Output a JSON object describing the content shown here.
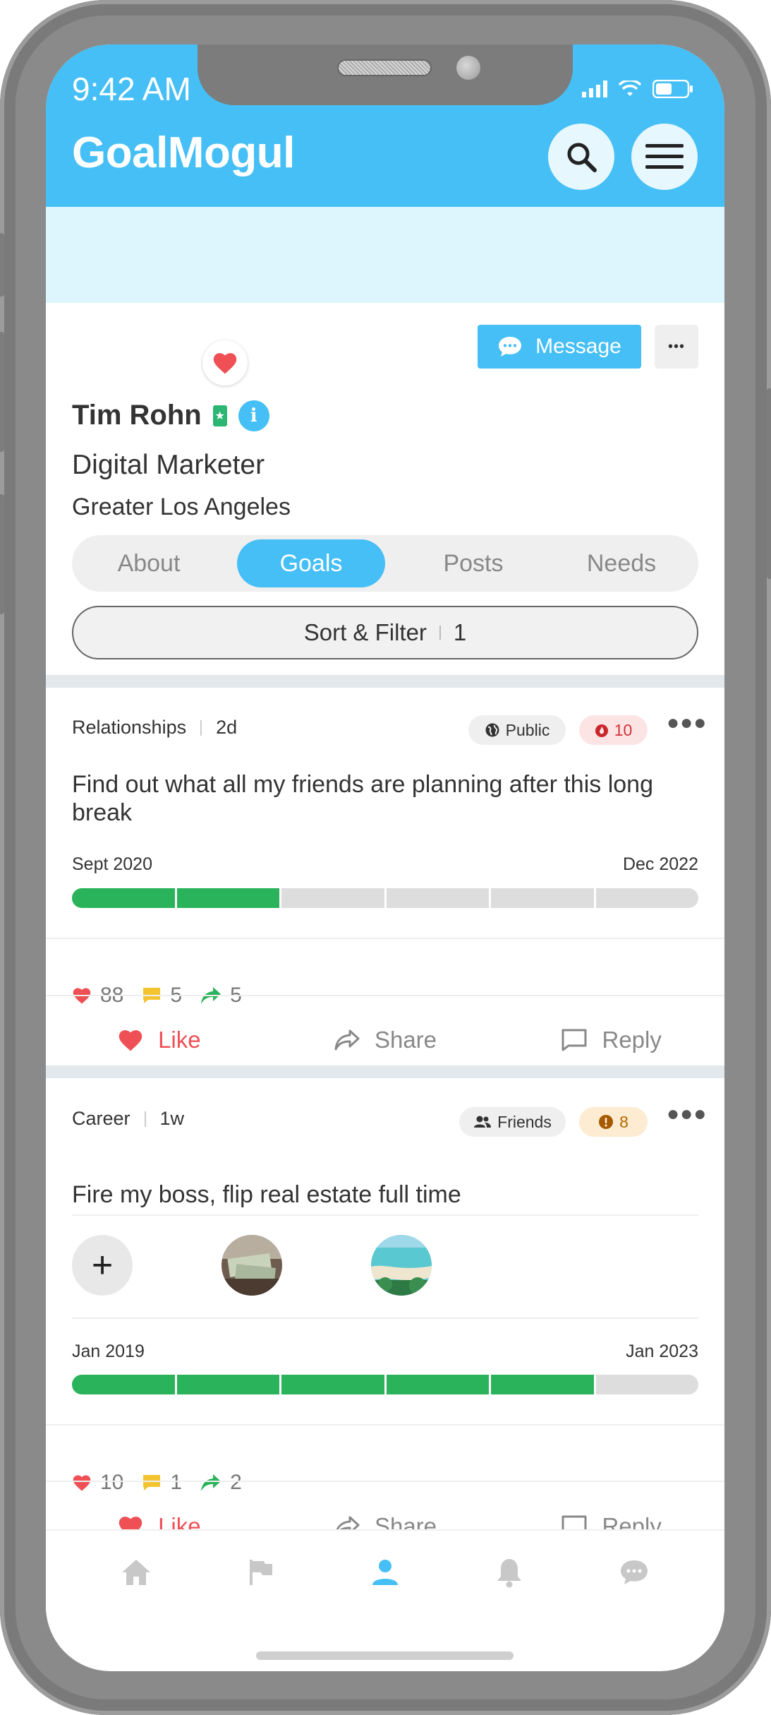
{
  "status_bar": {
    "time": "9:42 AM"
  },
  "app": {
    "name": "GoalMogul"
  },
  "profile": {
    "name": "Tim Rohn",
    "headline": "Digital Marketer",
    "location": "Greater Los Angeles",
    "message_label": "Message",
    "more_label": "•••"
  },
  "tabs": [
    {
      "label": "About",
      "active": false
    },
    {
      "label": "Goals",
      "active": true
    },
    {
      "label": "Posts",
      "active": false
    },
    {
      "label": "Needs",
      "active": false
    }
  ],
  "sort_filter": {
    "label": "Sort & Filter",
    "count": "1"
  },
  "goals": [
    {
      "category": "Relationships",
      "age": "2d",
      "privacy": "Public",
      "priority": "10",
      "title": "Find out what all my friends are planning after this long break",
      "start": "Sept 2020",
      "end": "Dec 2022",
      "progress_segments_filled": 2,
      "progress_segments_total": 6,
      "likes": "88",
      "comments": "5",
      "shares": "5"
    },
    {
      "category": "Career",
      "age": "1w",
      "privacy": "Friends",
      "priority": "8",
      "title": "Fire my boss, flip real estate full time",
      "start": "Jan 2019",
      "end": "Jan 2023",
      "progress_segments_filled": 5,
      "progress_segments_total": 6,
      "likes": "10",
      "comments": "1",
      "shares": "2"
    }
  ],
  "actions": {
    "like": "Like",
    "share": "Share",
    "reply": "Reply"
  },
  "colors": {
    "brand": "#45bff5",
    "cover": "#ddf6fe",
    "progress": "#2bb35b",
    "like": "#ee5055",
    "comment": "#f4c430",
    "share": "#2bb35b"
  },
  "bottom_nav": [
    "home-icon",
    "flag-icon",
    "profile-icon",
    "bell-icon",
    "chat-icon"
  ],
  "bottom_nav_active": "profile-icon"
}
